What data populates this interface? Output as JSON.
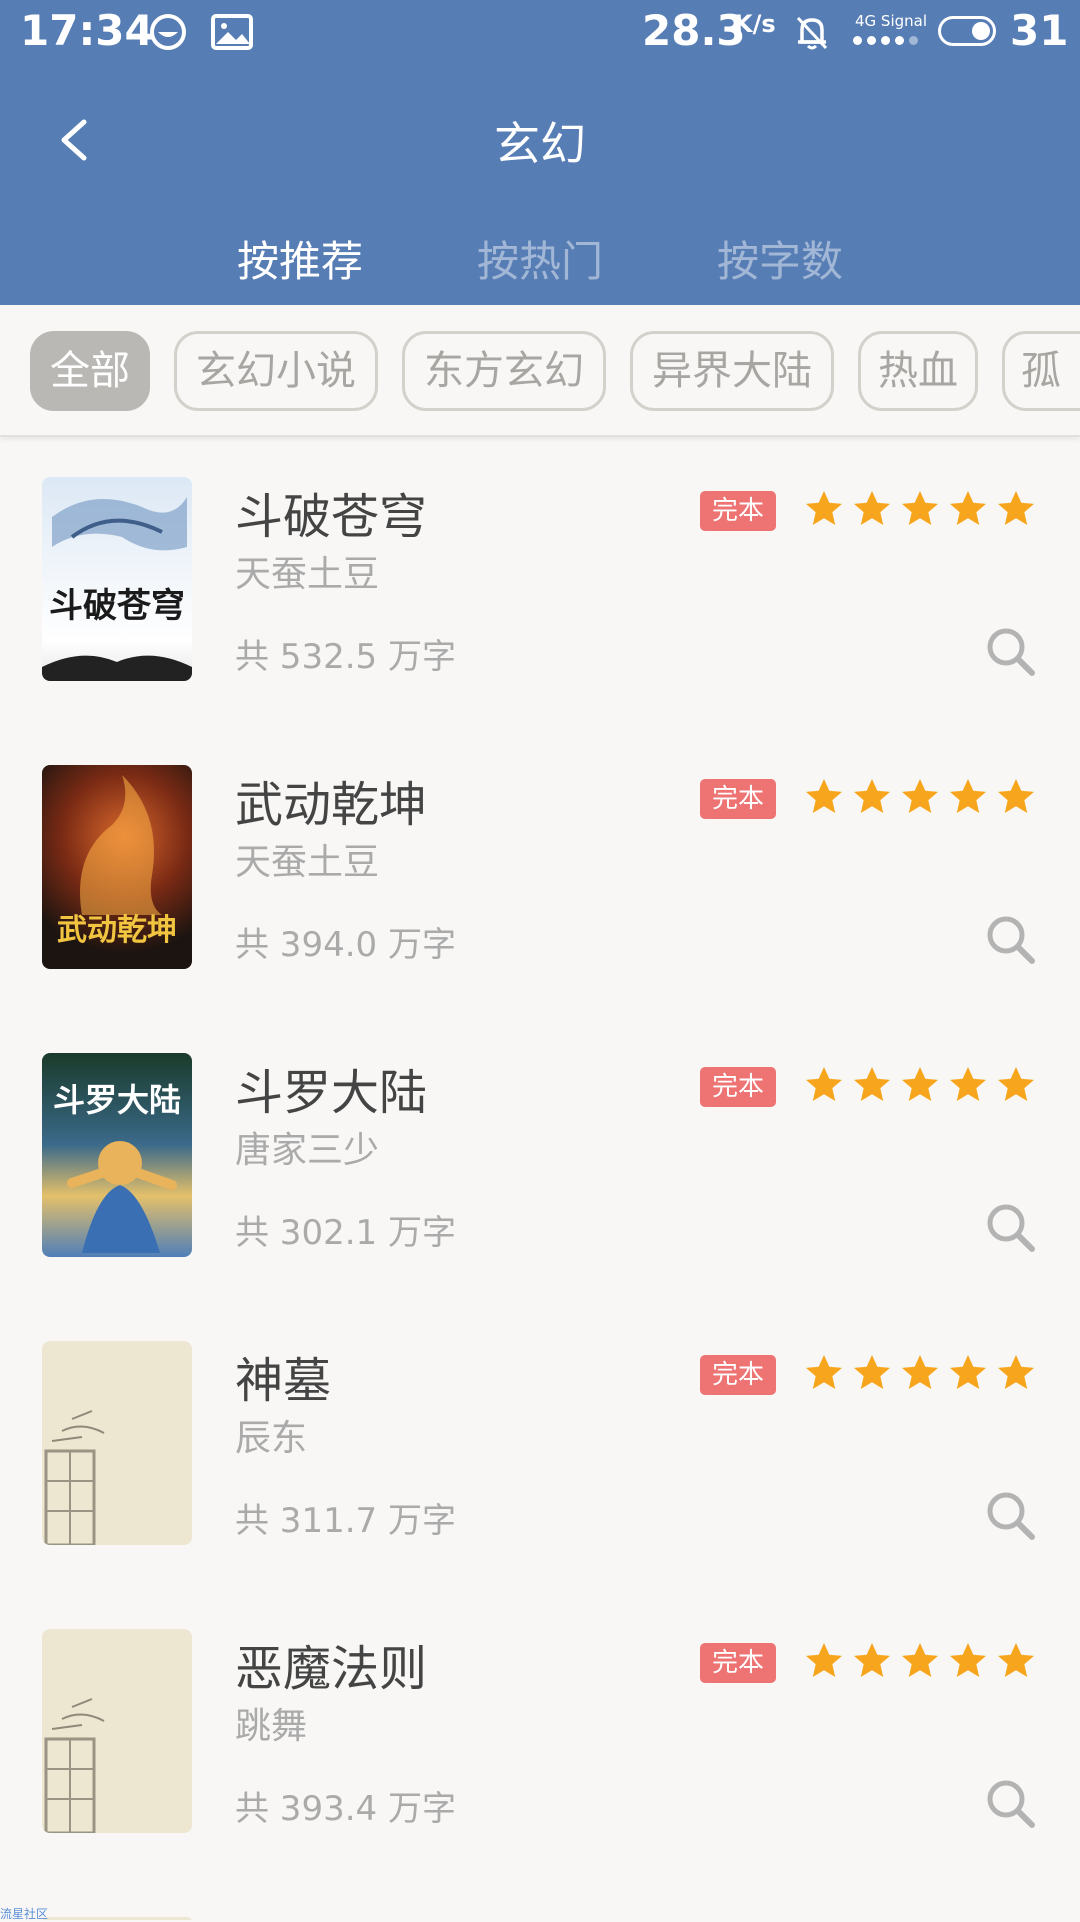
{
  "status_bar": {
    "time": "17:34",
    "speed": "28.3",
    "speed_unit": "K/s",
    "signal_label": "4G Signal",
    "battery": "31"
  },
  "header": {
    "title": "玄幻",
    "tabs": [
      {
        "label": "按推荐",
        "active": true
      },
      {
        "label": "按热门",
        "active": false
      },
      {
        "label": "按字数",
        "active": false
      }
    ]
  },
  "chips": [
    {
      "label": "全部",
      "active": true
    },
    {
      "label": "玄幻小说",
      "active": false
    },
    {
      "label": "东方玄幻",
      "active": false
    },
    {
      "label": "异界大陆",
      "active": false
    },
    {
      "label": "热血",
      "active": false
    },
    {
      "label": "孤",
      "active": false
    }
  ],
  "books": [
    {
      "title": "斗破苍穹",
      "author": "天蚕土豆",
      "words": "共 532.5 万字",
      "badge": "完本",
      "rating": 5,
      "cover_text": "斗破苍穹"
    },
    {
      "title": "武动乾坤",
      "author": "天蚕土豆",
      "words": "共 394.0 万字",
      "badge": "完本",
      "rating": 5,
      "cover_text": "武动乾坤"
    },
    {
      "title": "斗罗大陆",
      "author": "唐家三少",
      "words": "共 302.1 万字",
      "badge": "完本",
      "rating": 5,
      "cover_text": "斗罗大陆"
    },
    {
      "title": "神墓",
      "author": "辰东",
      "words": "共 311.7 万字",
      "badge": "完本",
      "rating": 5,
      "cover_text": ""
    },
    {
      "title": "恶魔法则",
      "author": "跳舞",
      "words": "共 393.4 万字",
      "badge": "完本",
      "rating": 5,
      "cover_text": ""
    }
  ],
  "footer_watermark": "流星社区",
  "colors": {
    "header_bg": "#577db5",
    "badge_bg": "#ee7373",
    "star": "#f7a51c",
    "chip_active_bg": "#b9b8b5"
  }
}
